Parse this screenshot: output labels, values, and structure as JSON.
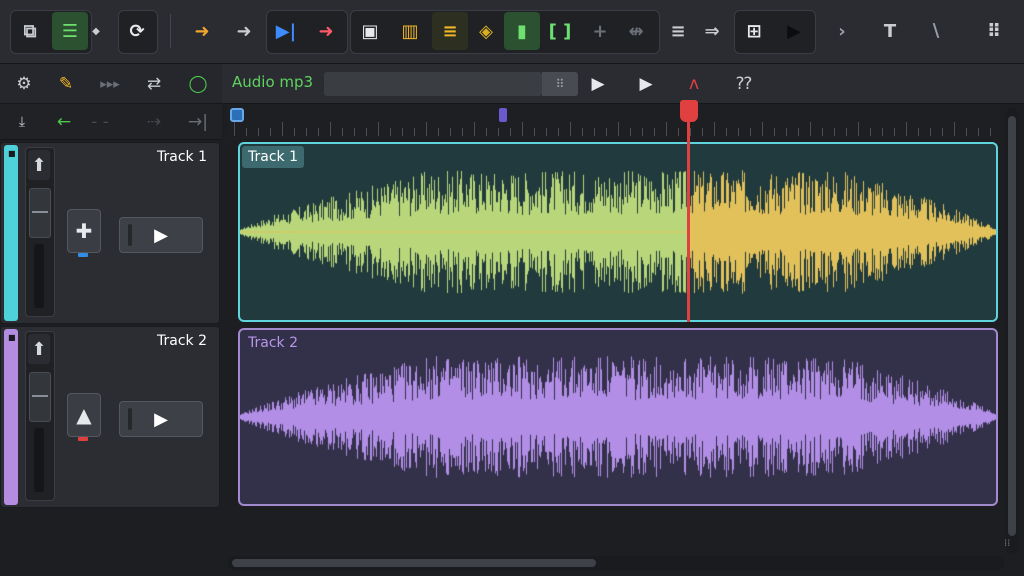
{
  "colors": {
    "accent_green": "#5fd35f",
    "track1": "#4fd1d9",
    "track2": "#b58de0",
    "wave1_left": "#b9d77a",
    "wave1_right": "#e2c15a",
    "wave2": "#b28ee6",
    "playhead": "#e04040"
  },
  "toolbar": {
    "groups": [
      {
        "name": "edit-group",
        "items": [
          "crop-icon",
          "list-icon"
        ]
      },
      {
        "name": "zoom-group",
        "items": [
          "zoom-icon"
        ]
      },
      {
        "name": "arrow-group",
        "items": [
          "arrow-right-orange-icon",
          "arrow-right-icon"
        ]
      },
      {
        "name": "transport-group",
        "items": [
          "fast-forward-icon",
          "arrow-right-red-icon"
        ]
      },
      {
        "name": "tools-group",
        "items": [
          "block-icon",
          "bars-icon",
          "align-icon",
          "diamond-icon",
          "marker-icon",
          "bracket-icon",
          "plus-icon",
          "split-icon"
        ]
      },
      {
        "name": "misc-group",
        "items": [
          "menu-icon",
          "forward-icon"
        ]
      },
      {
        "name": "layout-group",
        "items": [
          "grid-edit-icon",
          "play-icon"
        ]
      },
      {
        "name": "extra-group",
        "items": [
          "chevron-right-icon",
          "text-icon",
          "line-tool-icon",
          "apps-icon"
        ]
      }
    ]
  },
  "clip_bar": {
    "file_label": "Audio mp3"
  },
  "tracks": [
    {
      "name": "Track 1",
      "clip_label": "Track 1"
    },
    {
      "name": "Track 2",
      "clip_label": "Track 2"
    }
  ]
}
